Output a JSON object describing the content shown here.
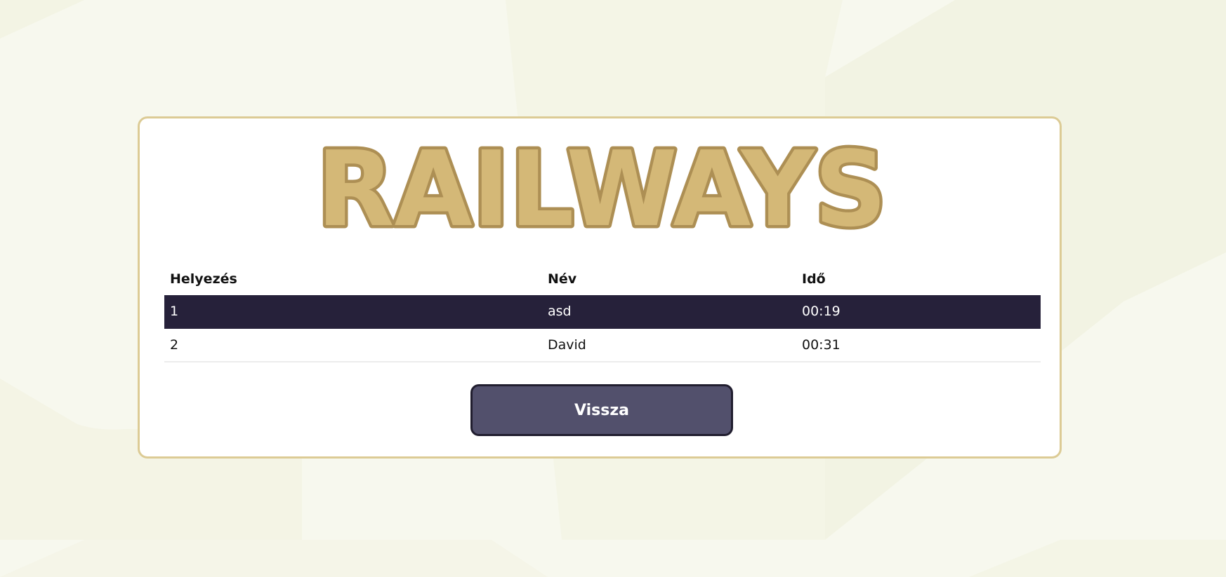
{
  "logo": {
    "text": "RAILWAYS",
    "fill_color": "#d4b877",
    "stroke_color": "#ad8f54"
  },
  "table": {
    "headers": {
      "rank": "Helyezés",
      "name": "Név",
      "time": "Idő"
    },
    "rows": [
      {
        "rank": "1",
        "name": "asd",
        "time": "00:19",
        "highlighted": true
      },
      {
        "rank": "2",
        "name": "David",
        "time": "00:31",
        "highlighted": false
      }
    ]
  },
  "back_button": {
    "label": "Vissza"
  },
  "colors": {
    "page_background": "#f7f8ee",
    "card_border": "#dccb95",
    "highlight_row": "#26213a",
    "button_background": "#52506c"
  }
}
